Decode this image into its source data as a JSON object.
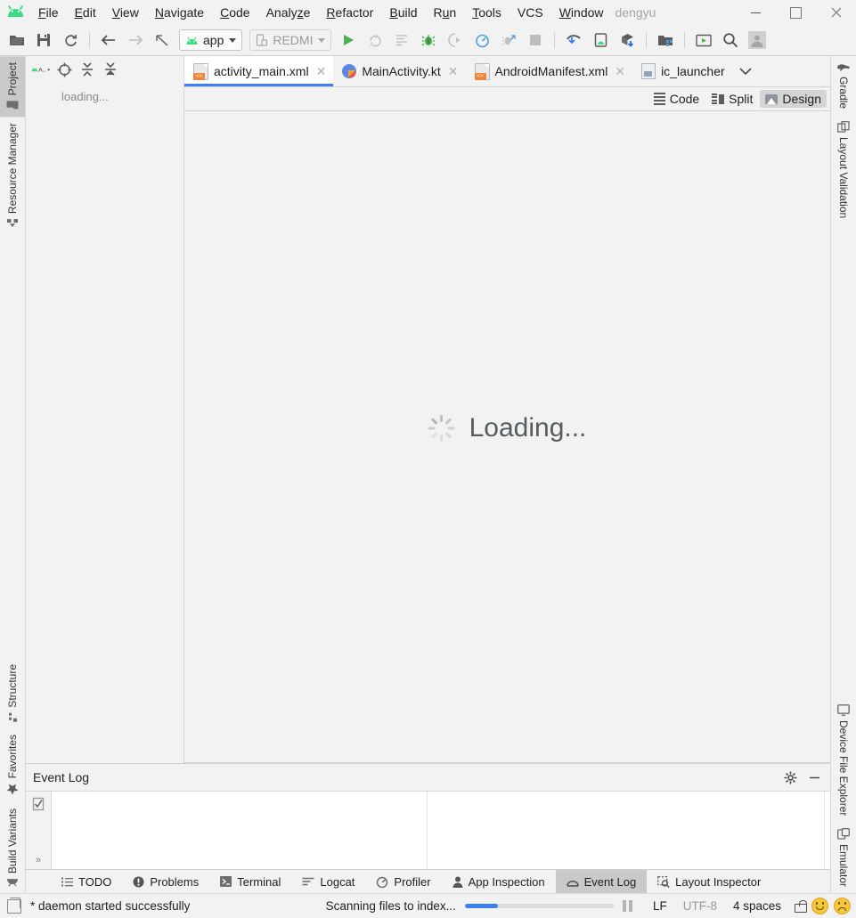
{
  "window": {
    "user_label": "dengyu",
    "controls": {
      "minimize": "—",
      "maximize": "□",
      "close": "✕"
    }
  },
  "menubar": {
    "logo_icon": "android-logo-icon",
    "items": [
      {
        "label": "File",
        "mnemonic": "F"
      },
      {
        "label": "Edit",
        "mnemonic": "E"
      },
      {
        "label": "View",
        "mnemonic": "V"
      },
      {
        "label": "Navigate",
        "mnemonic": "N"
      },
      {
        "label": "Code",
        "mnemonic": "C"
      },
      {
        "label": "Analyze",
        "mnemonic": "z"
      },
      {
        "label": "Refactor",
        "mnemonic": "R"
      },
      {
        "label": "Build",
        "mnemonic": "B"
      },
      {
        "label": "Run",
        "mnemonic": "u"
      },
      {
        "label": "Tools",
        "mnemonic": "T"
      },
      {
        "label": "VCS",
        "mnemonic": ""
      },
      {
        "label": "Window",
        "mnemonic": "W"
      }
    ]
  },
  "toolbar": {
    "buttons": [
      "open-folder-icon",
      "save-all-icon",
      "sync-icon",
      "back-icon",
      "forward-icon",
      "previous-edit-icon"
    ],
    "module_selector": {
      "label": "app",
      "icon": "android-module-icon"
    },
    "device_selector": {
      "label": "REDMI",
      "icon": "device-icon"
    },
    "run_buttons": [
      "run-icon",
      "rerun-icon",
      "edit-configurations-icon",
      "debug-icon",
      "run-with-coverage-icon",
      "profiler-icon",
      "attach-debugger-icon",
      "stop-icon"
    ],
    "right_buttons": [
      "sdk-manager-icon",
      "avd-manager-icon",
      "sync-project-icon",
      "project-structure-icon",
      "layout-inspector-icon",
      "search-everywhere-icon",
      "user-avatar-icon"
    ]
  },
  "left_rail": {
    "items": [
      {
        "label": "Project",
        "icon": "folder-icon",
        "active": true
      },
      {
        "label": "Resource Manager",
        "icon": "resource-manager-icon",
        "active": false
      },
      {
        "label": "Structure",
        "icon": "structure-icon",
        "active": false
      },
      {
        "label": "Favorites",
        "icon": "star-icon",
        "active": false
      },
      {
        "label": "Build Variants",
        "icon": "build-variants-icon",
        "active": false
      }
    ]
  },
  "right_rail": {
    "items": [
      {
        "label": "Gradle",
        "icon": "gradle-elephant-icon"
      },
      {
        "label": "Layout Validation",
        "icon": "layout-validation-icon"
      },
      {
        "label": "Device File Explorer",
        "icon": "monitor-icon"
      },
      {
        "label": "Emulator",
        "icon": "emulator-icon"
      }
    ]
  },
  "project_panel": {
    "toolbar_icons": [
      "android-view-selector-icon",
      "select-opened-file-icon",
      "expand-all-icon",
      "collapse-all-icon"
    ],
    "view_label": "A..",
    "status_text": "loading..."
  },
  "editor": {
    "tabs": [
      {
        "label": "activity_main.xml",
        "icon": "xml-layout-file-icon",
        "active": true,
        "closable": true
      },
      {
        "label": "MainActivity.kt",
        "icon": "kotlin-file-icon",
        "active": false,
        "closable": true
      },
      {
        "label": "AndroidManifest.xml",
        "icon": "xml-manifest-file-icon",
        "active": false,
        "closable": true
      },
      {
        "label": "ic_launcher",
        "icon": "image-file-icon",
        "active": false,
        "closable": false
      }
    ],
    "tab_overflow_icon": "chevron-down-icon",
    "view_modes": [
      {
        "label": "Code",
        "icon": "code-view-icon",
        "active": false
      },
      {
        "label": "Split",
        "icon": "split-view-icon",
        "active": false
      },
      {
        "label": "Design",
        "icon": "design-view-icon",
        "active": true
      }
    ],
    "canvas": {
      "loading_text": "Loading...",
      "spinner_icon": "loading-spinner-icon"
    }
  },
  "event_log": {
    "title": "Event Log",
    "settings_icon": "gear-icon",
    "hide_icon": "minimize-icon",
    "gutter_icons": [
      "mark-all-read-icon",
      "expand-chevrons-icon"
    ],
    "content": ""
  },
  "bottom_tabs": {
    "items": [
      {
        "label": "TODO",
        "icon": "todo-list-icon",
        "active": false
      },
      {
        "label": "Problems",
        "icon": "problems-icon",
        "active": false
      },
      {
        "label": "Terminal",
        "icon": "terminal-icon",
        "active": false
      },
      {
        "label": "Logcat",
        "icon": "logcat-icon",
        "active": false
      },
      {
        "label": "Profiler",
        "icon": "profiler-icon",
        "active": false
      },
      {
        "label": "App Inspection",
        "icon": "app-inspection-icon",
        "active": false
      },
      {
        "label": "Event Log",
        "icon": "event-log-icon",
        "active": true
      },
      {
        "label": "Layout Inspector",
        "icon": "layout-inspector-icon",
        "active": false
      }
    ]
  },
  "statusbar": {
    "toggle_icon": "toggle-toolwindows-icon",
    "message": "* daemon started successfully",
    "background_task": "Scanning files to index...",
    "progress_percent": 22,
    "pause_icon": "pause-icon",
    "line_separator": "LF",
    "encoding": "UTF-8",
    "indent": "4 spaces",
    "lock_icon": "unlocked-icon",
    "feedback_positive_icon": "smiley-happy-icon",
    "feedback_negative_icon": "smiley-sad-icon"
  },
  "colors": {
    "accent_blue": "#3d7ff0",
    "android_green": "#3ddc84",
    "xml_chip_orange": "#f0853c",
    "panel_bg": "#f2f2f2",
    "active_tab_bg": "#c9c9c9",
    "editor_bg": "#ffffff"
  }
}
